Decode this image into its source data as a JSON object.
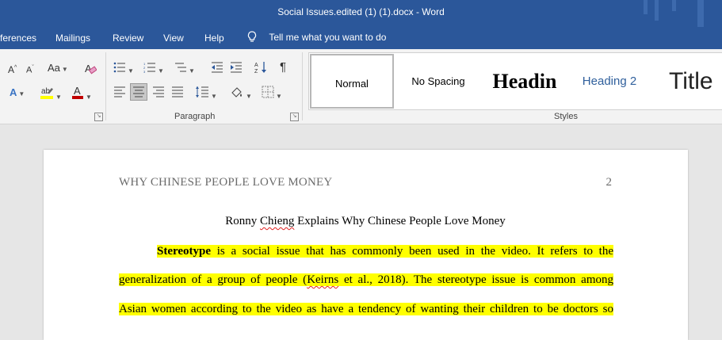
{
  "window": {
    "title": "Social Issues.edited (1) (1).docx  -  Word"
  },
  "menu": {
    "items": [
      "ferences",
      "Mailings",
      "Review",
      "View",
      "Help"
    ],
    "tell_me": "Tell me what you want to do"
  },
  "ribbon": {
    "paragraph_label": "Paragraph",
    "styles_label": "Styles",
    "font_case_label": "Aa",
    "styles": [
      "Normal",
      "No Spacing",
      "Headin",
      "Heading 2",
      "Title"
    ]
  },
  "document": {
    "header_title": "WHY CHINESE PEOPLE LOVE MONEY",
    "page_number": "2",
    "title_pre": "Ronny ",
    "title_squiggle": "Chieng",
    "title_post": " Explains Why Chinese People Love Money",
    "line1_bold": "Stereotype",
    "line1_rest": " is a social issue that has commonly been used in the video. It refers to the",
    "line2_pre": "generalization of a group of people (",
    "line2_squiggle": "Keirns",
    "line2_post": " et al., 2018). The stereotype issue is common among",
    "line3": "Asian women according to the video as have a tendency of wanting their children to be doctors so"
  },
  "colors": {
    "titlebar": "#2b579a",
    "highlight": "#ffff00",
    "squiggle": "#e02020"
  }
}
